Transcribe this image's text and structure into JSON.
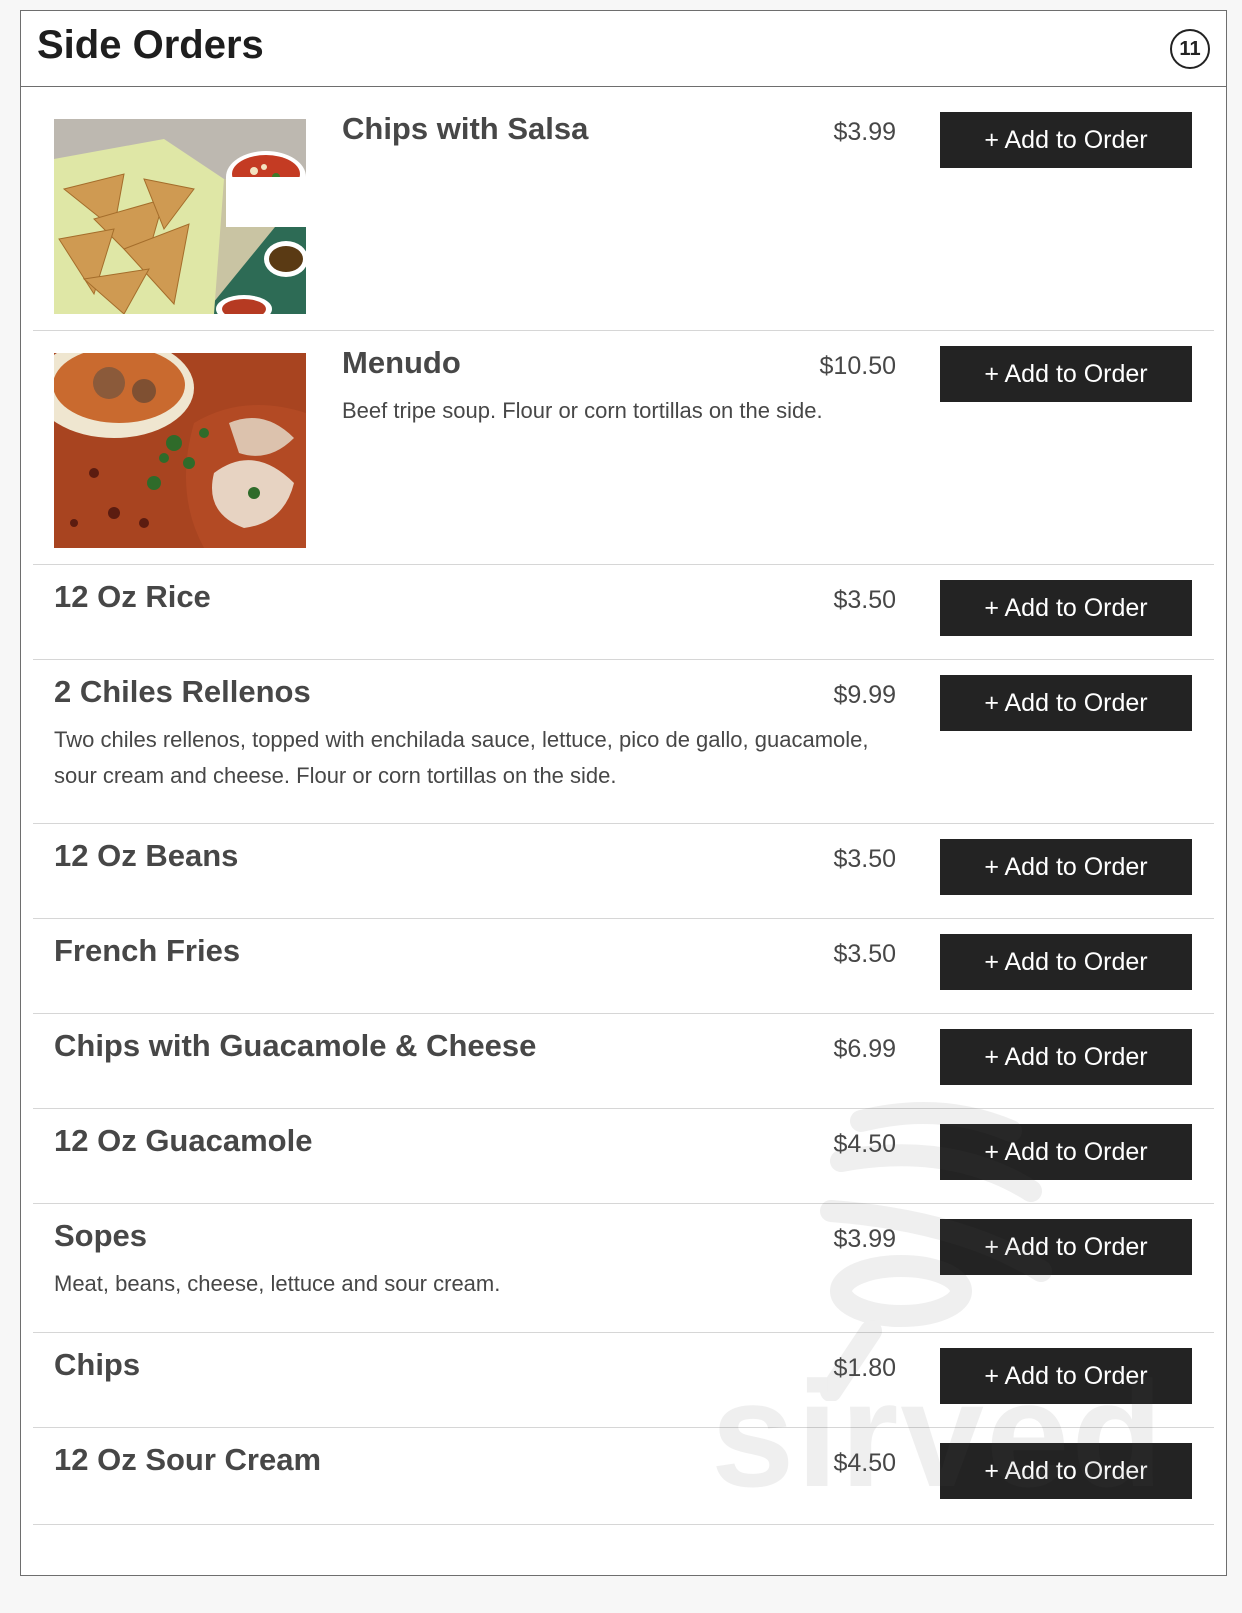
{
  "header": {
    "title": "Side Orders",
    "count": "11"
  },
  "add_label": "+ Add to Order",
  "watermark": "sirved",
  "items": [
    {
      "name": "Chips with Salsa",
      "price": "$3.99",
      "desc": ""
    },
    {
      "name": "Menudo",
      "price": "$10.50",
      "desc": "Beef tripe soup. Flour or corn tortillas on the side."
    },
    {
      "name": "12 Oz Rice",
      "price": "$3.50",
      "desc": ""
    },
    {
      "name": "2 Chiles Rellenos",
      "price": "$9.99",
      "desc": "Two chiles rellenos, topped with enchilada sauce, lettuce, pico de gallo, guacamole, sour cream and cheese. Flour or corn tortillas on the side."
    },
    {
      "name": "12 Oz Beans",
      "price": "$3.50",
      "desc": ""
    },
    {
      "name": "French Fries",
      "price": "$3.50",
      "desc": ""
    },
    {
      "name": "Chips with Guacamole & Cheese",
      "price": "$6.99",
      "desc": ""
    },
    {
      "name": "12 Oz Guacamole",
      "price": "$4.50",
      "desc": ""
    },
    {
      "name": "Sopes",
      "price": "$3.99",
      "desc": "Meat, beans, cheese, lettuce and sour cream."
    },
    {
      "name": "Chips",
      "price": "$1.80",
      "desc": ""
    },
    {
      "name": "12 Oz Sour Cream",
      "price": "$4.50",
      "desc": ""
    }
  ]
}
